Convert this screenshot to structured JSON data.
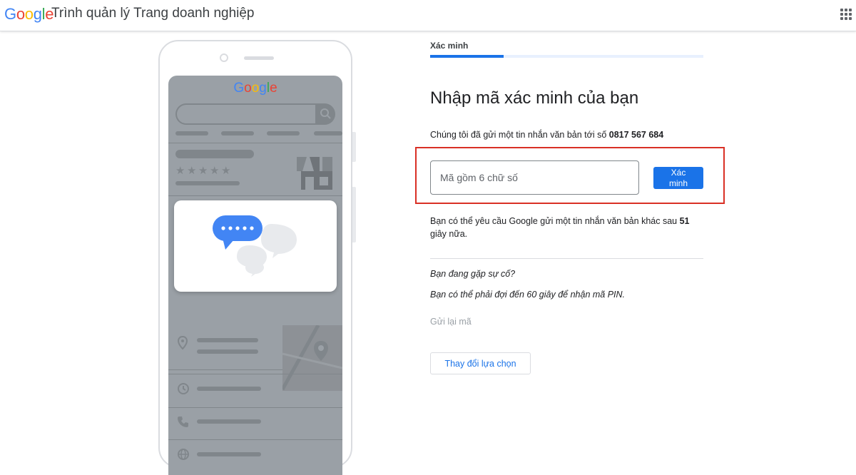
{
  "header": {
    "logo": [
      "G",
      "o",
      "o",
      "g",
      "l",
      "e"
    ],
    "product_name": "Trình quản lý Trang doanh nghiệp",
    "apps_icon": "apps-grid-icon"
  },
  "illustration": {
    "screen_logo": [
      "G",
      "o",
      "o",
      "g",
      "l",
      "e"
    ],
    "icons": [
      "search-icon",
      "storefront-icon",
      "chat-bubble-icon",
      "location-pin-icon",
      "map-pin-icon",
      "clock-icon",
      "phone-icon",
      "globe-icon"
    ]
  },
  "colors": {
    "google_blue": "#4285F4",
    "google_red": "#EA4335",
    "google_yellow": "#FBBC05",
    "google_green": "#34A853",
    "accent": "#1a73e8",
    "highlight_border": "#d93025"
  },
  "verify": {
    "step_label": "Xác minh",
    "progress": 0.27,
    "title": "Nhập mã xác minh của bạn",
    "sent_prefix": "Chúng tôi đã gửi một tin nhắn văn bản tới số ",
    "phone_number": "0817 567 684",
    "code_placeholder": "Mã gồm 6 chữ số",
    "code_value": "",
    "verify_button": "Xác minh",
    "resend_prefix": "Bạn có thể yêu cầu Google gửi một tin nhắn văn bản khác sau ",
    "resend_seconds": "51",
    "resend_suffix": " giây nữa.",
    "trouble_heading": "Bạn đang gặp sự cố?",
    "wait_text": "Bạn có thể phải đợi đến 60 giây để nhận mã PIN.",
    "resend_link": "Gửi lại mã",
    "change_button": "Thay đổi lựa chọn"
  }
}
